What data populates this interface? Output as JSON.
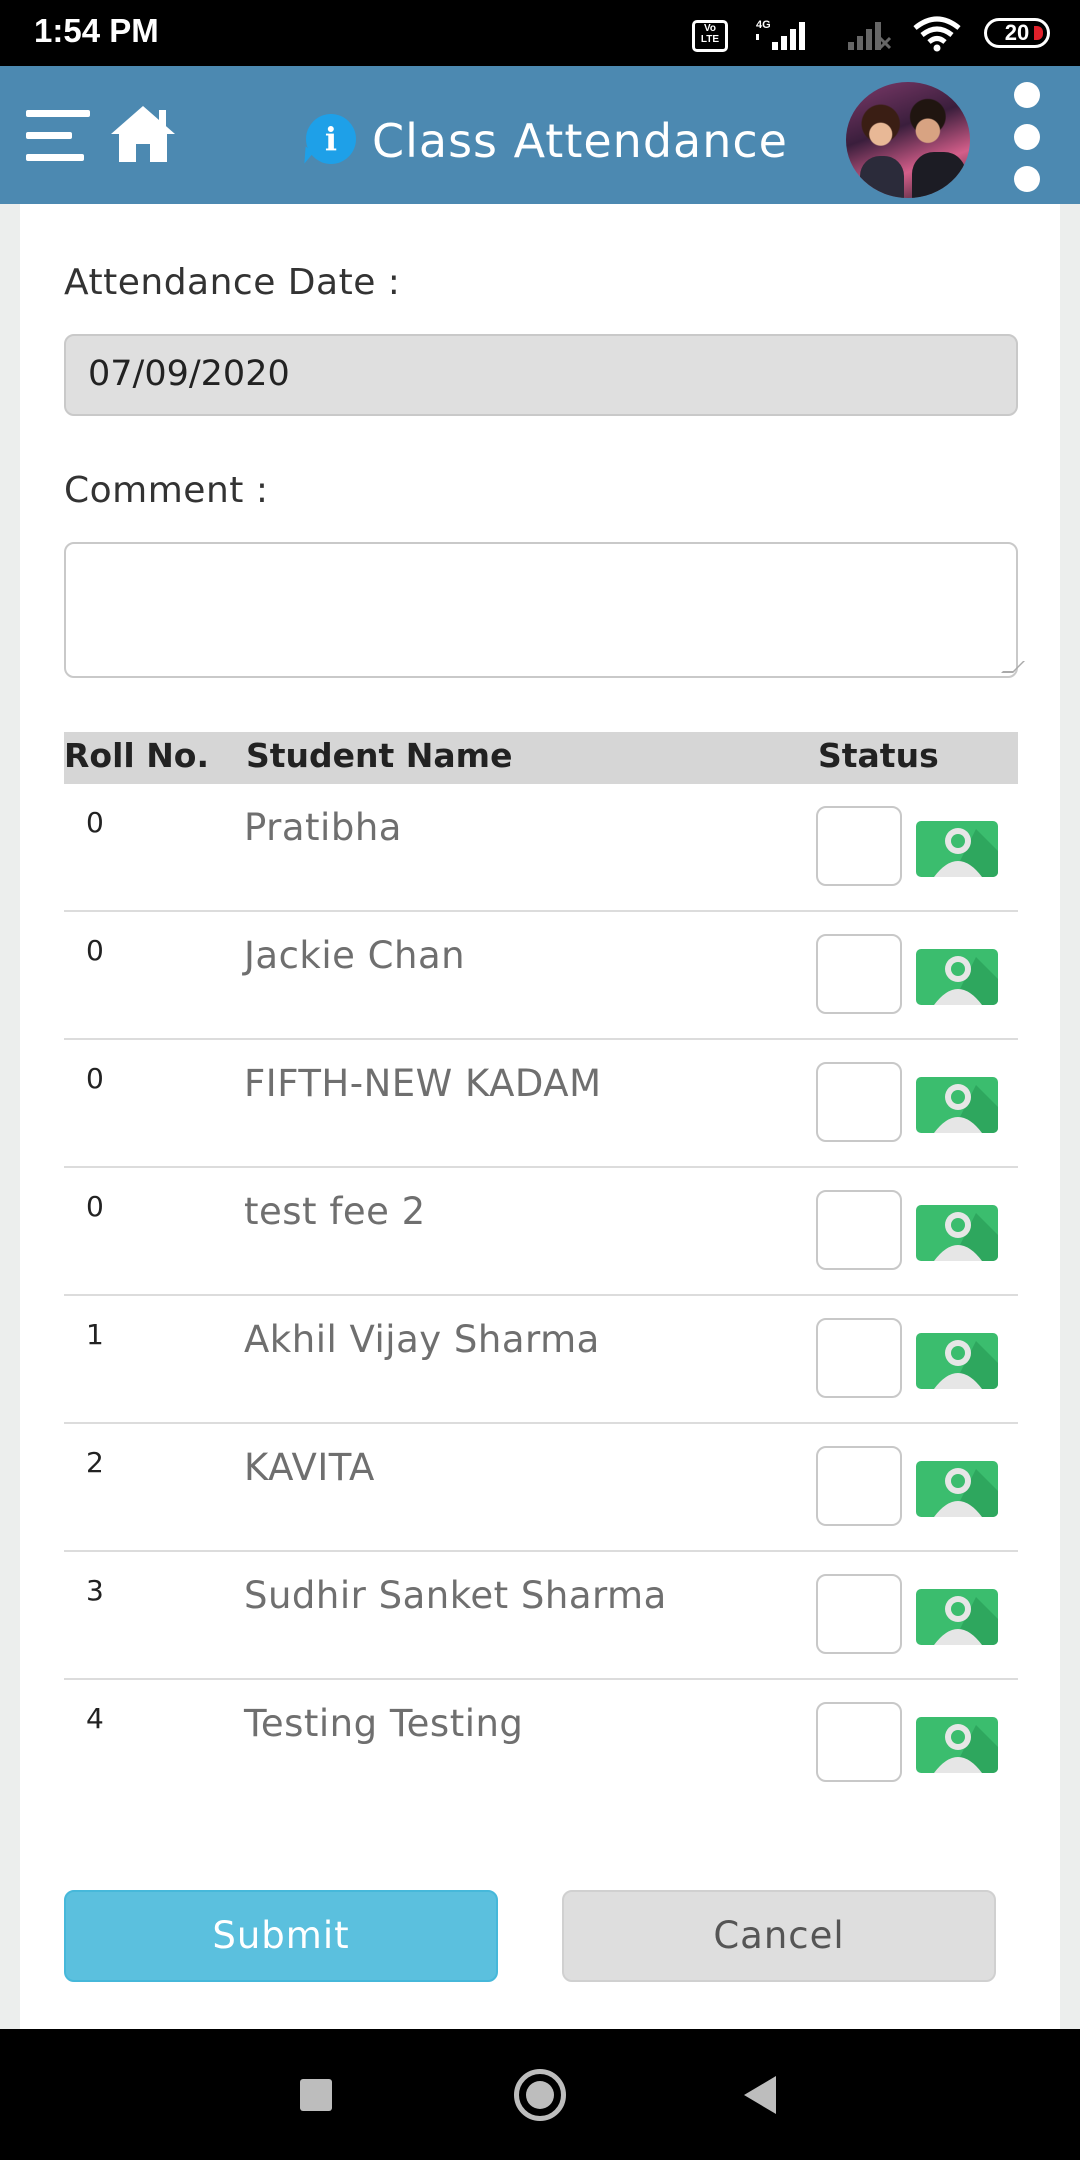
{
  "status_bar": {
    "time": "1:54 PM",
    "volte_label": "Vo LTE",
    "network_label": "4G",
    "battery": "20"
  },
  "app_bar": {
    "title": "Class Attendance",
    "icons": [
      "menu-icon",
      "home-icon",
      "info-icon",
      "avatar",
      "more-vert-icon"
    ]
  },
  "form": {
    "date_label": "Attendance Date :",
    "date_value": "07/09/2020",
    "comment_label": "Comment :",
    "comment_value": ""
  },
  "table": {
    "headers": {
      "roll": "Roll No.",
      "name": "Student Name",
      "status": "Status"
    },
    "rows": [
      {
        "roll": "0",
        "name": "Pratibha"
      },
      {
        "roll": "0",
        "name": "Jackie Chan"
      },
      {
        "roll": "0",
        "name": "FIFTH-NEW KADAM"
      },
      {
        "roll": "0",
        "name": "test fee 2"
      },
      {
        "roll": "1",
        "name": "Akhil Vijay Sharma"
      },
      {
        "roll": "2",
        "name": "KAVITA"
      },
      {
        "roll": "3",
        "name": "Sudhir Sanket Sharma"
      },
      {
        "roll": "4",
        "name": "Testing Testing"
      }
    ]
  },
  "buttons": {
    "submit": "Submit",
    "cancel": "Cancel"
  },
  "colors": {
    "app_bar": "#4c89b1",
    "submit": "#5bc0de",
    "photo_icon": "#3bbd6e",
    "info_icon": "#1ea0e8"
  }
}
